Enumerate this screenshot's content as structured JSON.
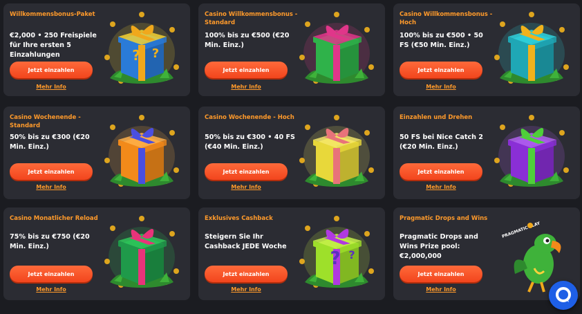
{
  "cards": [
    {
      "title": "Willkommensbonus-Paket",
      "desc": "€2,000 • 250 Freispiele für Ihre ersten 5 Einzahlungen",
      "button": "Jetzt einzahlen",
      "link": "Mehr Info",
      "art": "gift-box-icon",
      "colors": {
        "box": "#2a7bd8",
        "ribbon": "#f0a81c",
        "accent": "#f3d234"
      }
    },
    {
      "title": "Casino Willkommensbonus - Standard",
      "desc": "100% bis zu €500 (€20 Min. Einz.)",
      "button": "Jetzt einzahlen",
      "link": "Mehr Info",
      "art": "gift-box-icon",
      "colors": {
        "box": "#2fb24a",
        "ribbon": "#e0368a",
        "accent": "#e0368a"
      }
    },
    {
      "title": "Casino Willkommensbonus - Hoch",
      "desc": "100% bis zu €500 • 50 FS (€50 Min. Einz.)",
      "button": "Jetzt einzahlen",
      "link": "Mehr Info",
      "art": "gift-box-icon",
      "colors": {
        "box": "#1fa7b5",
        "ribbon": "#f0b21c",
        "accent": "#2fd3de"
      }
    },
    {
      "title": "Casino Wochenende - Standard",
      "desc": "50% bis zu €300 (€20 Min. Einz.)",
      "button": "Jetzt einzahlen",
      "link": "Mehr Info",
      "art": "gift-box-icon",
      "colors": {
        "box": "#f28a1a",
        "ribbon": "#4a4fe0",
        "accent": "#ffb04a"
      }
    },
    {
      "title": "Casino Wochenende - Hoch",
      "desc": "50% bis zu €300 • 40 FS (€40 Min. Einz.)",
      "button": "Jetzt einzahlen",
      "link": "Mehr Info",
      "art": "gift-box-icon",
      "colors": {
        "box": "#e8d83a",
        "ribbon": "#e8737a",
        "accent": "#f5e86a"
      }
    },
    {
      "title": "Einzahlen und Drehen",
      "desc": "50 FS bei Nice Catch 2 (€20 Min. Einz.)",
      "button": "Jetzt einzahlen",
      "link": "Mehr Info",
      "art": "gift-box-icon",
      "colors": {
        "box": "#8a2fd6",
        "ribbon": "#4fcf3a",
        "accent": "#b060f0"
      }
    },
    {
      "title": "Casino Monatlicher Reload",
      "desc": "75% bis zu €750 (€20 Min. Einz.)",
      "button": "Jetzt einzahlen",
      "link": "Mehr Info",
      "art": "gift-box-icon",
      "colors": {
        "box": "#1f9a4a",
        "ribbon": "#e8337a",
        "accent": "#2fc85a"
      }
    },
    {
      "title": "Exklusives Cashback",
      "desc": "Steigern Sie Ihr Cashback JEDE Woche",
      "button": "Jetzt einzahlen",
      "link": "Mehr Info",
      "art": "mystery-gift-icon",
      "colors": {
        "box": "#9ee02a",
        "ribbon": "#b03ae0",
        "accent": "#c6f04a"
      }
    },
    {
      "title": "Pragmatic Drops and Wins",
      "desc": "Pragmatic Drops and Wins Prize pool: €2,000,000",
      "button": "Jetzt einzahlen",
      "link": "Mehr Info",
      "art": "parrot-mascot-icon",
      "brand": "PRAGMATIC PLAY",
      "colors": {
        "box": "#3fb23a",
        "ribbon": "#f0a81c",
        "accent": "#ffd23a"
      }
    }
  ],
  "chat": {
    "icon": "chat-icon",
    "color": "#1e5fe6"
  }
}
